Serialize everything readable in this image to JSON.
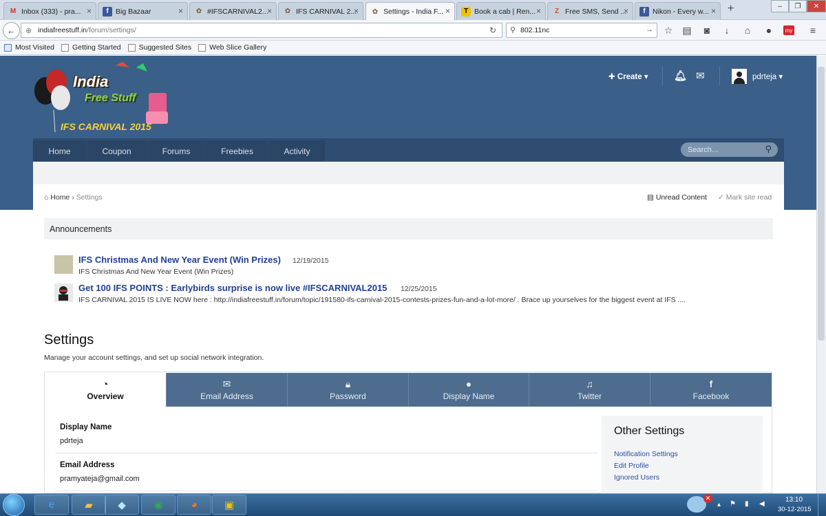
{
  "browser": {
    "tabs": [
      {
        "title": "Inbox (333) - pra...",
        "icon": "gmail-icon"
      },
      {
        "title": "Big Bazaar",
        "icon": "facebook-icon"
      },
      {
        "title": "#IFSCARNIVAL2...",
        "icon": "ifs-icon"
      },
      {
        "title": "IFS CARNIVAL 2...",
        "icon": "ifs-icon"
      },
      {
        "title": "Settings - India F...",
        "icon": "ifs-icon"
      },
      {
        "title": "Book a cab | Ren...",
        "icon": "taxi-icon"
      },
      {
        "title": "Free SMS, Send ...",
        "icon": "sms-icon"
      },
      {
        "title": "Nikon - Every w...",
        "icon": "facebook-icon"
      }
    ],
    "url_domain": "indiafreestuff.in",
    "url_path": "/forum/settings/",
    "search_value": "802.11nc",
    "bookmarks": [
      "Most Visited",
      "Getting Started",
      "Suggested Sites",
      "Web Slice Gallery"
    ]
  },
  "site": {
    "logo_line1": "India",
    "logo_line2": "Free Stuff",
    "logo_line3": "IFS CARNIVAL 2015",
    "create_label": "Create",
    "username": "pdrteja",
    "nav": [
      "Home",
      "Coupon",
      "Forums",
      "Freebies",
      "Activity"
    ],
    "search_placeholder": "Search...",
    "breadcrumb": {
      "home": "Home",
      "current": "Settings"
    },
    "unread_label": "Unread Content",
    "mark_read_label": "Mark site read",
    "announcements_label": "Announcements",
    "announcements": [
      {
        "title": "IFS Christmas And New Year Event (Win Prizes)",
        "date": "12/19/2015",
        "desc": "IFS Christmas And New Year Event (Win Prizes)"
      },
      {
        "title": "Get 100 IFS POINTS : Earlybirds surprise is now live #IFSCARNIVAL2015",
        "date": "12/25/2015",
        "desc": "IFS CARNIVAL 2015 IS LIVE NOW here : http://indiafreestuff.in/forum/topic/191580-ifs-carnival-2015-contests-prizes-fun-and-a-lot-more/ . Brace up yourselves for the biggest event at IFS ...."
      }
    ],
    "settings_title": "Settings",
    "settings_desc": "Manage your account settings, and set up social network integration.",
    "settings_tabs": [
      "Overview",
      "Email Address",
      "Password",
      "Display Name",
      "Twitter",
      "Facebook"
    ],
    "fields": [
      {
        "label": "Display Name",
        "value": "pdrteja"
      },
      {
        "label": "Email Address",
        "value": "pramyateja@gmail.com"
      }
    ],
    "other_settings_title": "Other Settings",
    "other_links": [
      "Notification Settings",
      "Edit Profile",
      "Ignored Users"
    ]
  },
  "taskbar": {
    "time": "13:10",
    "date": "30-12-2015"
  },
  "colors": {
    "header": "#3a5f88",
    "nav": "#2e4d70",
    "tab": "#4d6c8e",
    "link": "#1f3f97"
  }
}
